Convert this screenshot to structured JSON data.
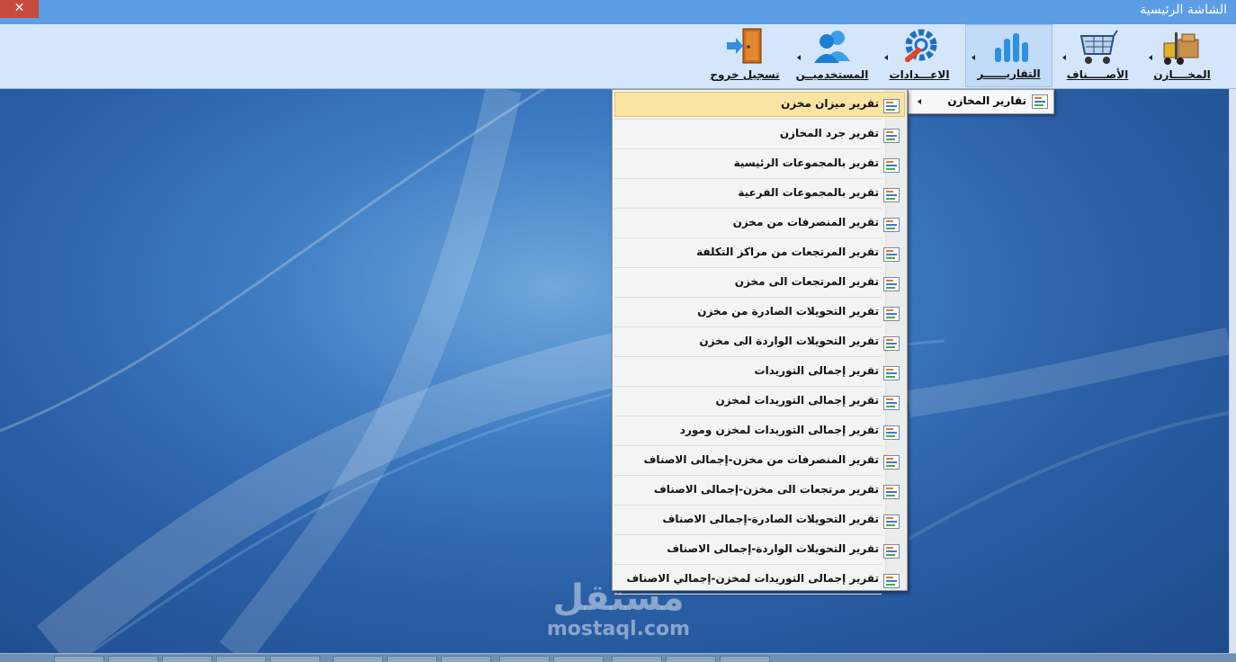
{
  "window": {
    "title": "الشاشة الرئيسية",
    "close_glyph": "✕"
  },
  "ribbon": {
    "items": [
      {
        "label": "المخــــازن",
        "icon": "warehouse-forklift-icon"
      },
      {
        "label": "الأصـــــناف",
        "icon": "shopping-cart-icon"
      },
      {
        "label": "التقاريــــــر",
        "icon": "bar-chart-icon"
      },
      {
        "label": "الاعـــدادات",
        "icon": "gear-wrench-icon"
      },
      {
        "label": "المستخدميــن",
        "icon": "users-icon"
      },
      {
        "label": "تسجيل خروج",
        "icon": "exit-door-icon"
      }
    ]
  },
  "submenu": {
    "label": "تقارير المخازن"
  },
  "reports": [
    "تقرير ميزان مخزن",
    "تقرير جرد المخازن",
    "تقرير بالمجموعات الرئيسية",
    "تقرير بالمجموعات الفرعية",
    "تقرير المنصرفات من مخزن",
    "تقرير المرتجعات من مراكز التكلفة",
    "تقرير المرتجعات الى مخزن",
    "تقرير التحويلات الصادرة من مخزن",
    "تقرير التحويلات الواردة الى مخزن",
    "تقرير إجمالى التوريدات",
    "تقرير إجمالى التوريدات لمخزن",
    "تقرير إجمالى التوريدات لمخزن ومورد",
    "تقرير المنصرفات من مخزن-إجمالى الاصناف",
    "تقرير مرتجعات الى مخزن-إجمالى الاصناف",
    "تقرير التحويلات الصادرة-إجمالى الاصناف",
    "تقرير التحويلات الواردة-إجمالى الاصناف",
    "تقرير إجمالى التوريدات لمخزن-إجمالي الاصناف"
  ],
  "highlighted_index": 0,
  "watermark": {
    "arabic": "مستقل",
    "latin": "mostaql.com"
  },
  "colors": {
    "titlebar": "#5b9ee6",
    "close": "#c74a3f",
    "ribbon": "#d6e6fa",
    "highlight": "#fbe3a4"
  }
}
